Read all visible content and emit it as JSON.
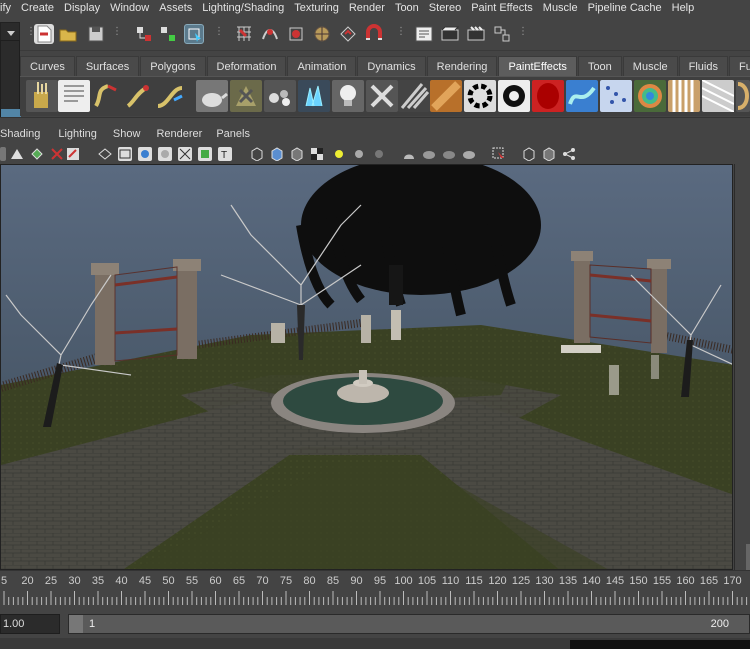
{
  "menubar": {
    "items": [
      "ify",
      "Create",
      "Display",
      "Window",
      "Assets",
      "Lighting/Shading",
      "Texturing",
      "Render",
      "Toon",
      "Stereo",
      "Paint Effects",
      "Muscle",
      "Pipeline Cache",
      "Help"
    ]
  },
  "shelf": {
    "tabs": [
      "Curves",
      "Surfaces",
      "Polygons",
      "Deformation",
      "Animation",
      "Dynamics",
      "Rendering",
      "PaintEffects",
      "Toon",
      "Muscle",
      "Fluids",
      "Fu"
    ],
    "active_tab": "PaintEffects"
  },
  "panel": {
    "menus": [
      "Shading",
      "Lighting",
      "Show",
      "Renderer",
      "Panels"
    ]
  },
  "timeslider": {
    "ticks": [
      "5",
      "20",
      "25",
      "30",
      "35",
      "40",
      "45",
      "50",
      "55",
      "60",
      "65",
      "70",
      "75",
      "80",
      "85",
      "90",
      "95",
      "100",
      "105",
      "110",
      "115",
      "120",
      "125",
      "130",
      "135",
      "140",
      "145",
      "150",
      "155",
      "160",
      "165",
      "170"
    ]
  },
  "range": {
    "start_value": "1.00",
    "range_start": "1",
    "range_end": "200"
  },
  "colors": {
    "ui_bg": "#444444",
    "viewport_sky_top": "#5a6a80",
    "viewport_sky_bottom": "#3c4a57",
    "active_tab": "#5d5d5d",
    "highlight": "#5285a6"
  }
}
